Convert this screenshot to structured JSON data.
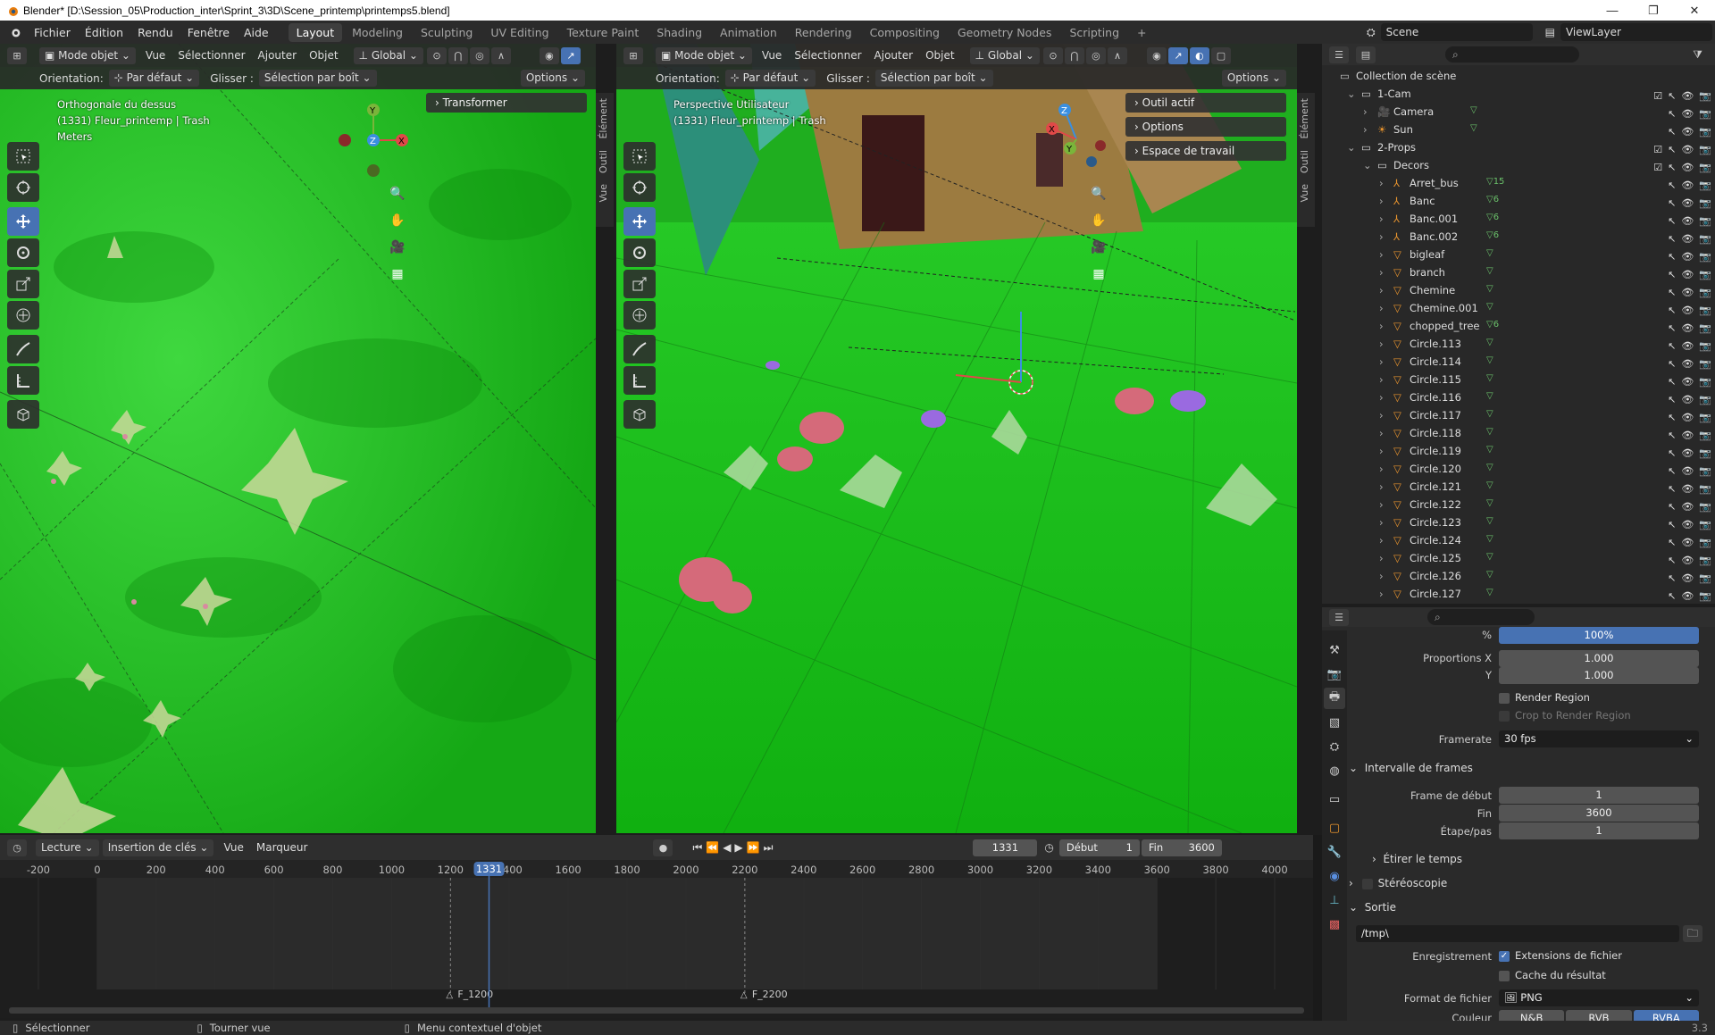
{
  "window": {
    "title": "Blender* [D:\\Session_05\\Production_inter\\Sprint_3\\3D\\Scene_printemp\\printemps5.blend]",
    "controls": [
      "—",
      "❐",
      "✕"
    ]
  },
  "menu": {
    "items": [
      "Fichier",
      "Édition",
      "Rendu",
      "Fenêtre",
      "Aide"
    ],
    "workspaces": [
      "Layout",
      "Modeling",
      "Sculpting",
      "UV Editing",
      "Texture Paint",
      "Shading",
      "Animation",
      "Rendering",
      "Compositing",
      "Geometry Nodes",
      "Scripting"
    ],
    "active_workspace": "Layout",
    "scene": "Scene",
    "view_layer": "ViewLayer"
  },
  "viewport_left": {
    "mode": "Mode objet",
    "menus": [
      "Vue",
      "Sélectionner",
      "Ajouter",
      "Objet"
    ],
    "transform": "Global",
    "orientation_label": "Orientation:",
    "orientation": "Par défaut",
    "drag_label": "Glisser :",
    "drag": "Sélection par boît",
    "options": "Options",
    "overlay_lines": [
      "Orthogonale du dessus",
      "(1331) Fleur_printemp | Trash",
      "Meters"
    ],
    "panel": "Transformer",
    "tabs": [
      "Élément",
      "Outil",
      "Vue"
    ],
    "axis_labels": [
      "Y",
      "Z",
      "X"
    ]
  },
  "viewport_right": {
    "mode": "Mode objet",
    "menus": [
      "Vue",
      "Sélectionner",
      "Ajouter",
      "Objet"
    ],
    "transform": "Global",
    "orientation_label": "Orientation:",
    "orientation": "Par défaut",
    "drag_label": "Glisser :",
    "drag": "Sélection par boît",
    "options": "Options",
    "overlay_lines": [
      "Perspective Utilisateur",
      "(1331) Fleur_printemp | Trash"
    ],
    "panels": [
      "Outil actif",
      "Options",
      "Espace de travail"
    ],
    "tabs": [
      "Élément",
      "Outil",
      "Vue"
    ],
    "axis_labels": [
      "Z",
      "X",
      "Y"
    ]
  },
  "outliner": {
    "root": "Collection de scène",
    "rows": [
      {
        "name": "1-Cam",
        "type": "collection",
        "depth": 1
      },
      {
        "name": "Camera",
        "type": "camera",
        "depth": 2
      },
      {
        "name": "Sun",
        "type": "light",
        "depth": 2
      },
      {
        "name": "2-Props",
        "type": "collection",
        "depth": 1
      },
      {
        "name": "Decors",
        "type": "collection",
        "depth": 2
      },
      {
        "name": "Arret_bus",
        "type": "empty",
        "depth": 3,
        "badge": "15"
      },
      {
        "name": "Banc",
        "type": "empty",
        "depth": 3,
        "badge": "6"
      },
      {
        "name": "Banc.001",
        "type": "empty",
        "depth": 3,
        "badge": "6"
      },
      {
        "name": "Banc.002",
        "type": "empty",
        "depth": 3,
        "badge": "6"
      },
      {
        "name": "bigleaf",
        "type": "mesh",
        "depth": 3
      },
      {
        "name": "branch",
        "type": "mesh",
        "depth": 3
      },
      {
        "name": "Chemine",
        "type": "mesh",
        "depth": 3
      },
      {
        "name": "Chemine.001",
        "type": "mesh",
        "depth": 3
      },
      {
        "name": "chopped_tree",
        "type": "mesh",
        "depth": 3,
        "badge": "6"
      },
      {
        "name": "Circle.113",
        "type": "mesh",
        "depth": 3
      },
      {
        "name": "Circle.114",
        "type": "mesh",
        "depth": 3
      },
      {
        "name": "Circle.115",
        "type": "mesh",
        "depth": 3
      },
      {
        "name": "Circle.116",
        "type": "mesh",
        "depth": 3
      },
      {
        "name": "Circle.117",
        "type": "mesh",
        "depth": 3
      },
      {
        "name": "Circle.118",
        "type": "mesh",
        "depth": 3
      },
      {
        "name": "Circle.119",
        "type": "mesh",
        "depth": 3
      },
      {
        "name": "Circle.120",
        "type": "mesh",
        "depth": 3
      },
      {
        "name": "Circle.121",
        "type": "mesh",
        "depth": 3
      },
      {
        "name": "Circle.122",
        "type": "mesh",
        "depth": 3
      },
      {
        "name": "Circle.123",
        "type": "mesh",
        "depth": 3
      },
      {
        "name": "Circle.124",
        "type": "mesh",
        "depth": 3
      },
      {
        "name": "Circle.125",
        "type": "mesh",
        "depth": 3
      },
      {
        "name": "Circle.126",
        "type": "mesh",
        "depth": 3
      },
      {
        "name": "Circle.127",
        "type": "mesh",
        "depth": 3
      }
    ]
  },
  "properties": {
    "percent_label": "%",
    "percent": "100%",
    "aspect_x_label": "Proportions X",
    "aspect_x": "1.000",
    "aspect_y_label": "Y",
    "aspect_y": "1.000",
    "render_region": "Render Region",
    "crop_region": "Crop to Render Region",
    "framerate_label": "Framerate",
    "framerate": "30 fps",
    "frame_range_title": "Intervalle de frames",
    "frame_start_label": "Frame de début",
    "frame_start": "1",
    "frame_end_label": "Fin",
    "frame_end": "3600",
    "frame_step_label": "Étape/pas",
    "frame_step": "1",
    "time_stretch": "Étirer le temps",
    "stereoscopy": "Stéréoscopie",
    "output_title": "Sortie",
    "output_path": "/tmp\\",
    "saving_label": "Enregistrement",
    "file_ext": "Extensions de fichier",
    "cache_result": "Cache du résultat",
    "file_format_label": "Format de fichier",
    "file_format": "PNG",
    "color_label": "Couleur",
    "color_modes": [
      "N&B",
      "RVB",
      "RVBA"
    ],
    "color_active": "RVBA"
  },
  "timeline": {
    "menus": [
      "Lecture",
      "Insertion de clés",
      "Vue",
      "Marqueur"
    ],
    "current_frame": "1331",
    "start_label": "Début",
    "start": "1",
    "end_label": "Fin",
    "end": "3600",
    "ticks": [
      "-200",
      "0",
      "200",
      "400",
      "600",
      "800",
      "1000",
      "1200",
      "1400",
      "1600",
      "1800",
      "2000",
      "2200",
      "2400",
      "2600",
      "2800",
      "3000",
      "3200",
      "3400",
      "3600",
      "3800",
      "4000"
    ],
    "markers": [
      {
        "label": "F_1200",
        "frame": 1200
      },
      {
        "label": "F_2200",
        "frame": 2200
      }
    ],
    "frame_min": -300,
    "frame_max": 4100
  },
  "status": {
    "items": [
      "Sélectionner",
      "Tourner vue",
      "Menu contextuel d'objet"
    ],
    "version": "3.3"
  },
  "colors": {
    "accent": "#4772b3",
    "grass": "#20c020",
    "playhead": "#4772b3"
  }
}
